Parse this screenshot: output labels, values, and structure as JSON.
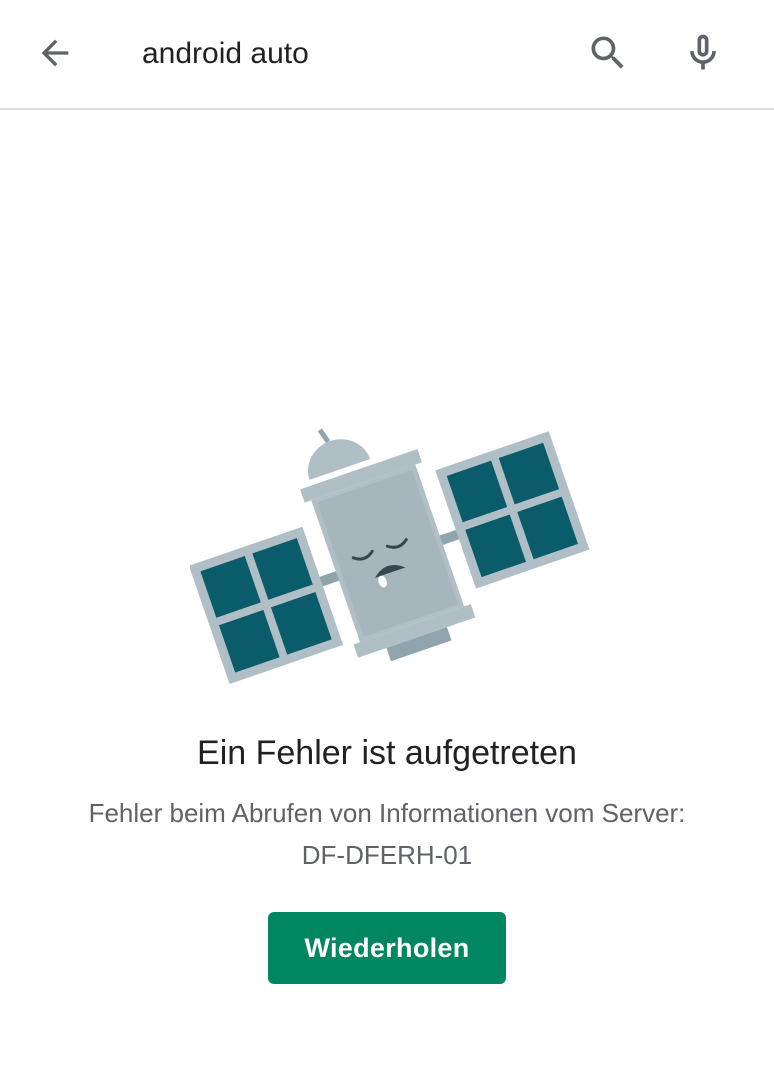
{
  "search": {
    "query": "android auto",
    "back_icon": "arrow-back-icon",
    "search_icon": "search-icon",
    "mic_icon": "mic-icon"
  },
  "error": {
    "illustration": "sleeping-satellite-illustration",
    "title": "Ein Fehler ist aufgetreten",
    "message_line1": "Fehler beim Abrufen von Informationen vom Server:",
    "message_line2": "DF-DFERH-01",
    "retry_label": "Wiederholen"
  },
  "colors": {
    "accent": "#01875f",
    "panel": "#0b5c6b",
    "body": "#b0bec5",
    "text_primary": "#202124",
    "text_secondary": "#5f6368"
  }
}
